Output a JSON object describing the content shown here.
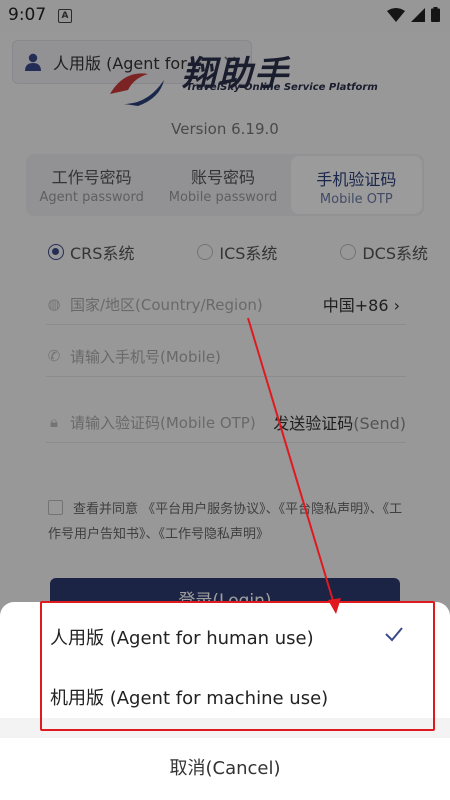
{
  "status_bar": {
    "time": "9:07",
    "notif_icon": "A"
  },
  "header": {
    "version_dropdown": "人用版 (Agent for ...",
    "brand": "翔助手",
    "brand_sub": "TravelSky Online Service Platform"
  },
  "version_text": "Version 6.19.0",
  "tabs": [
    {
      "label": "工作号密码",
      "sub": "Agent password"
    },
    {
      "label": "账号密码",
      "sub": "Mobile password"
    },
    {
      "label": "手机验证码",
      "sub": "Mobile OTP"
    }
  ],
  "systems": [
    {
      "label": "CRS系统",
      "selected": true
    },
    {
      "label": "ICS系统",
      "selected": false
    },
    {
      "label": "DCS系统",
      "selected": false
    }
  ],
  "form": {
    "country_placeholder": "国家/地区(Country/Region)",
    "country_value": "中国+86",
    "mobile_placeholder": "请输入手机号(Mobile)",
    "otp_placeholder": "请输入验证码(Mobile OTP)",
    "send_label": "发送验证码",
    "send_sub": "(Send)"
  },
  "agreement": "查看并同意 《平台用户服务协议》、《平台隐私声明》、《工作号用户告知书》、《工作号隐私声明》",
  "login_label": "登录(Login)",
  "sheet": {
    "options": [
      {
        "label": "人用版 (Agent for human use)",
        "selected": true
      },
      {
        "label": "机用版 (Agent for machine use)",
        "selected": false
      }
    ],
    "cancel": "取消(Cancel)"
  },
  "colors": {
    "accent": "#2c3a6e",
    "annotation": "#e0191e",
    "check": "#3a4a8a"
  }
}
